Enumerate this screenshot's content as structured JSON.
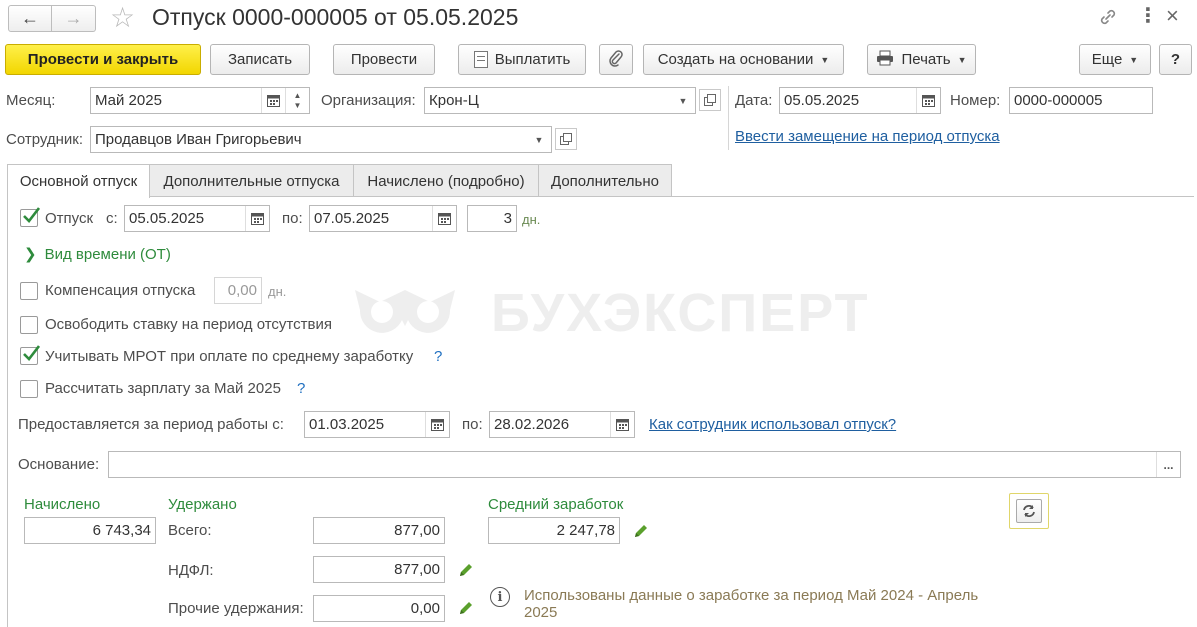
{
  "window": {
    "title": "Отпуск 0000-000005 от 05.05.2025"
  },
  "toolbar": {
    "post_close": "Провести и закрыть",
    "save": "Записать",
    "post": "Провести",
    "pay": "Выплатить",
    "create_based": "Создать на основании",
    "print": "Печать",
    "more": "Еще",
    "help": "?"
  },
  "header": {
    "month_label": "Месяц:",
    "month_value": "Май 2025",
    "org_label": "Организация:",
    "org_value": "Крон-Ц",
    "date_label": "Дата:",
    "date_value": "05.05.2025",
    "number_label": "Номер:",
    "number_value": "0000-000005",
    "employee_label": "Сотрудник:",
    "employee_value": "Продавцов Иван Григорьевич",
    "substitution_link": "Ввести замещение на период отпуска"
  },
  "tabs": [
    {
      "label": "Основной отпуск",
      "active": true
    },
    {
      "label": "Дополнительные отпуска",
      "active": false
    },
    {
      "label": "Начислено (подробно)",
      "active": false
    },
    {
      "label": "Дополнительно",
      "active": false
    }
  ],
  "vacation": {
    "checked": true,
    "label": "Отпуск",
    "from_label": "с:",
    "from_value": "05.05.2025",
    "to_label": "по:",
    "to_value": "07.05.2025",
    "days_value": "3",
    "days_unit": "дн.",
    "time_type_label": "Вид времени (ОТ)"
  },
  "compensation": {
    "checked": false,
    "label": "Компенсация отпуска",
    "value": "0,00",
    "unit": "дн."
  },
  "release_rate": {
    "checked": false,
    "label": "Освободить ставку на период отсутствия"
  },
  "mrot": {
    "checked": true,
    "label": "Учитывать МРОТ при оплате по среднему заработку",
    "help": "?"
  },
  "calc_salary": {
    "checked": false,
    "label": "Рассчитать зарплату за Май 2025",
    "help": "?"
  },
  "period": {
    "label": "Предоставляется за период работы с:",
    "from_value": "01.03.2025",
    "to_label": "по:",
    "to_value": "28.02.2026",
    "usage_link": "Как сотрудник использовал отпуск?"
  },
  "basis": {
    "label": "Основание:",
    "value": "",
    "select_btn": "..."
  },
  "totals": {
    "accrued_title": "Начислено",
    "accrued_value": "6 743,34",
    "withheld_title": "Удержано",
    "total_label": "Всего:",
    "total_value": "877,00",
    "ndfl_label": "НДФЛ:",
    "ndfl_value": "877,00",
    "other_label": "Прочие удержания:",
    "other_value": "0,00",
    "avg_title": "Средний заработок",
    "avg_value": "2 247,78",
    "info_text": "Использованы данные о заработке за период Май 2024 - Апрель 2025"
  },
  "watermark": "БУХЭКСПЕРТ",
  "colors": {
    "accent_yellow": "#f5dc1a",
    "green_label": "#2e8b3c",
    "link_blue": "#1f5fa0"
  }
}
